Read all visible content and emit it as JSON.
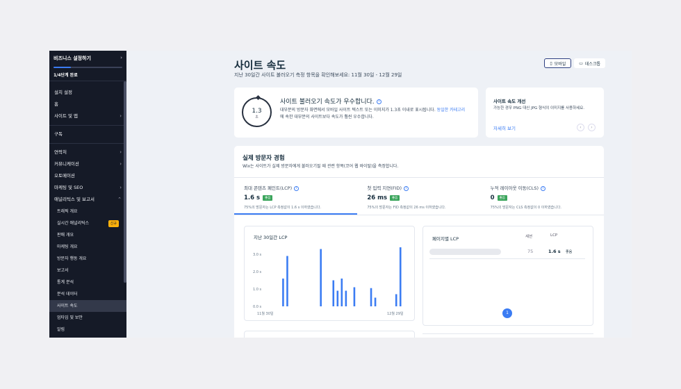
{
  "sidebar": {
    "setup": {
      "title": "비즈니스 설정하기",
      "progress": 0.25,
      "status": "1/4단계 완료"
    },
    "items": [
      {
        "label": "설치 설정",
        "chevron": false
      },
      {
        "label": "홈",
        "chevron": false
      },
      {
        "label": "사이트 및 앱",
        "chevron": true
      },
      {
        "label": "구독",
        "chevron": false
      },
      {
        "label": "연락처",
        "chevron": true
      },
      {
        "label": "커뮤니케이션",
        "chevron": true
      },
      {
        "label": "오토메이션",
        "chevron": false
      },
      {
        "label": "마케팅 및 SEO",
        "chevron": true
      },
      {
        "label": "애널리틱스 및 보고서",
        "chevron": true
      }
    ],
    "analytics_items": [
      {
        "label": "트래픽 개요"
      },
      {
        "label": "실시간 애널리틱스",
        "badge": "신규"
      },
      {
        "label": "판매 개요"
      },
      {
        "label": "마케팅 개요"
      },
      {
        "label": "방문자 행동 개요"
      },
      {
        "label": "보고서"
      },
      {
        "label": "통계 분석"
      },
      {
        "label": "분석 데이터"
      },
      {
        "label": "사이트 속도"
      },
      {
        "label": "업타임 및 보안"
      },
      {
        "label": "알림"
      }
    ]
  },
  "header": {
    "title": "사이트 속도",
    "subtitle": "지난 30일간 사이트 불러오기 측정 항목을 확인해보세요: 11월 30일 - 12월 29일",
    "mobile_label": "모바일",
    "desktop_label": "데스크톱"
  },
  "speed_card": {
    "gauge_value": "1.3",
    "gauge_unit": "초",
    "title": "사이트 불러오기 속도가 우수합니다.",
    "desc_before": "대부분의 방문자 화면에서 모바일 사이트 텍스트 또는 이미지가 1.3초 이내로 표시됩니다. ",
    "desc_link": "동일한 카테고리",
    "desc_after": "에 속한 대부분의 사이트보다 속도가 훨씬 우수합니다."
  },
  "improve_card": {
    "title": "사이트 속도 개선",
    "desc": "가능한 경우 PNG 대신 JPG 형식의 이미지를 사용하세요.",
    "link": "자세히 보기"
  },
  "experience": {
    "title": "실제 방문자 경험",
    "subtitle": "Wix는 사이트가 실제 방문자에게 불러오기될 때 관련 항목(코어 웹 바이탈)을 측정합니다.",
    "metrics": [
      {
        "name": "최대 콘텐츠 페인트(LCP)",
        "value": "1.6 s",
        "badge": "좋음",
        "desc": "75%의 방문자는 LCP 측정값이 1.6 s 이하였습니다."
      },
      {
        "name": "첫 입력 지연(FID)",
        "value": "26 ms",
        "badge": "좋음",
        "desc": "75%의 방문자는 FID 측정값이 26 ms 이하였습니다."
      },
      {
        "name": "누적 레이아웃 이동(CLS)",
        "value": "0",
        "badge": "좋음",
        "desc": "75%의 방문자는 CLS 측정값이 0 이하였습니다."
      }
    ]
  },
  "chart_data": {
    "type": "bar",
    "title": "지난 30일간 LCP",
    "xlabel": "",
    "ylabel": "",
    "ylim": [
      0,
      3.0
    ],
    "yticks": [
      "0.0 s",
      "1.0 s",
      "2.0 s",
      "3.0 s"
    ],
    "x_labels": [
      "11월 30일",
      "12월 29일"
    ],
    "color": "#3b7cf3",
    "values": [
      0,
      0,
      0,
      0,
      1.6,
      2.9,
      0,
      0,
      0,
      0,
      0,
      0,
      0,
      3.3,
      0,
      0,
      1.5,
      0.9,
      1.6,
      0.9,
      0,
      1.1,
      0,
      0,
      0,
      1.05,
      0.5,
      0,
      0,
      0,
      0,
      0.7,
      3.4,
      0
    ]
  },
  "page_table": {
    "title": "페이지별 LCP",
    "col_sessions": "세션",
    "col_lcp": "LCP",
    "rows": [
      {
        "sessions": "75",
        "lcp": "1.6 s",
        "badge": "좋음"
      }
    ],
    "page": "1"
  }
}
